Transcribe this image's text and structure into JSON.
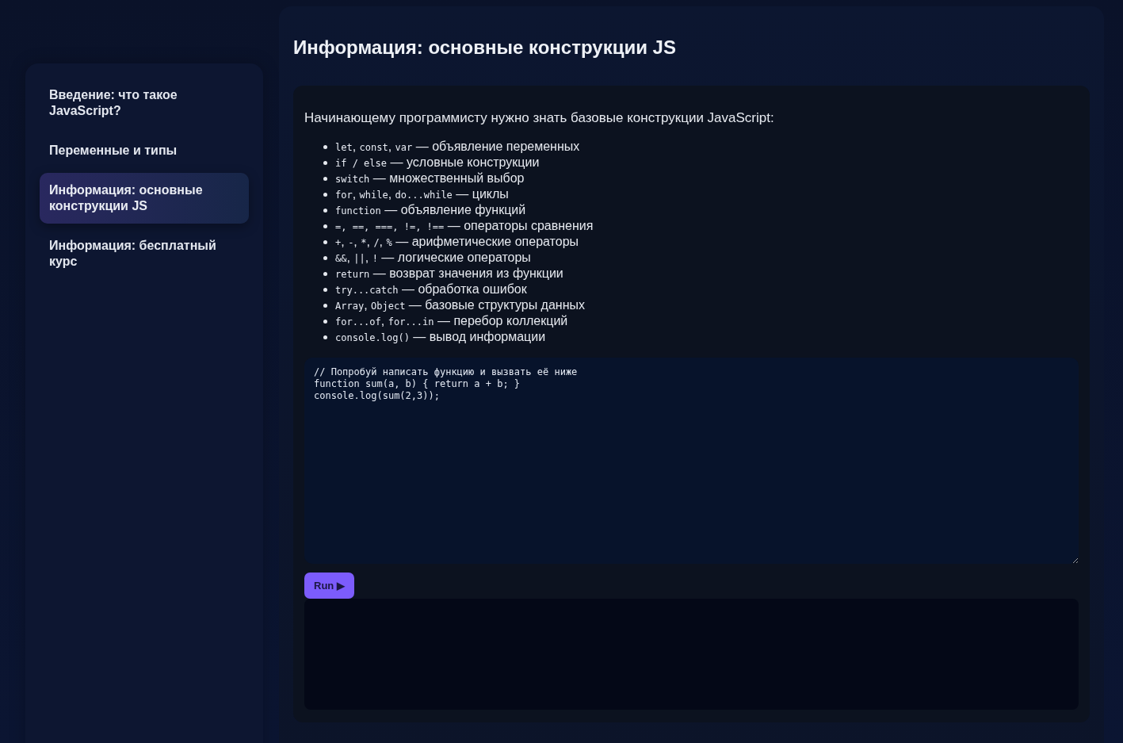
{
  "sidebar": {
    "items": [
      {
        "label": "Введение: что такое JavaScript?",
        "selected": false
      },
      {
        "label": "Переменные и типы",
        "selected": false
      },
      {
        "label": "Информация: основные конструкции JS",
        "selected": true
      },
      {
        "label": "Информация: бесплатный курс",
        "selected": false
      }
    ]
  },
  "main": {
    "title": "Информация: основные конструкции JS",
    "intro": "Начинающему программисту нужно знать базовые конструкции JavaScript:",
    "constructs": [
      {
        "parts": [
          {
            "kind": "code",
            "text": "let"
          },
          {
            "kind": "text",
            "text": ", "
          },
          {
            "kind": "code",
            "text": "const"
          },
          {
            "kind": "text",
            "text": ", "
          },
          {
            "kind": "code",
            "text": "var"
          },
          {
            "kind": "text",
            "text": " — объявление переменных"
          }
        ]
      },
      {
        "parts": [
          {
            "kind": "code",
            "text": "if / else"
          },
          {
            "kind": "text",
            "text": " — условные конструкции"
          }
        ]
      },
      {
        "parts": [
          {
            "kind": "code",
            "text": "switch"
          },
          {
            "kind": "text",
            "text": " — множественный выбор"
          }
        ]
      },
      {
        "parts": [
          {
            "kind": "code",
            "text": "for"
          },
          {
            "kind": "text",
            "text": ", "
          },
          {
            "kind": "code",
            "text": "while"
          },
          {
            "kind": "text",
            "text": ", "
          },
          {
            "kind": "code",
            "text": "do...while"
          },
          {
            "kind": "text",
            "text": " — циклы"
          }
        ]
      },
      {
        "parts": [
          {
            "kind": "code",
            "text": "function"
          },
          {
            "kind": "text",
            "text": " — объявление функций"
          }
        ]
      },
      {
        "parts": [
          {
            "kind": "code",
            "text": "=, ==, ===, !=, !=="
          },
          {
            "kind": "text",
            "text": " — операторы сравнения"
          }
        ]
      },
      {
        "parts": [
          {
            "kind": "code",
            "text": "+"
          },
          {
            "kind": "text",
            "text": ", "
          },
          {
            "kind": "code",
            "text": "-"
          },
          {
            "kind": "text",
            "text": ", "
          },
          {
            "kind": "code",
            "text": "*"
          },
          {
            "kind": "text",
            "text": ", "
          },
          {
            "kind": "code",
            "text": "/"
          },
          {
            "kind": "text",
            "text": ", "
          },
          {
            "kind": "code",
            "text": "%"
          },
          {
            "kind": "text",
            "text": " — арифметические операторы"
          }
        ]
      },
      {
        "parts": [
          {
            "kind": "code",
            "text": "&&"
          },
          {
            "kind": "text",
            "text": ", "
          },
          {
            "kind": "code",
            "text": "||"
          },
          {
            "kind": "text",
            "text": ", "
          },
          {
            "kind": "code",
            "text": "!"
          },
          {
            "kind": "text",
            "text": " — логические операторы"
          }
        ]
      },
      {
        "parts": [
          {
            "kind": "code",
            "text": "return"
          },
          {
            "kind": "text",
            "text": " — возврат значения из функции"
          }
        ]
      },
      {
        "parts": [
          {
            "kind": "code",
            "text": "try...catch"
          },
          {
            "kind": "text",
            "text": " — обработка ошибок"
          }
        ]
      },
      {
        "parts": [
          {
            "kind": "code",
            "text": "Array"
          },
          {
            "kind": "text",
            "text": ", "
          },
          {
            "kind": "code",
            "text": "Object"
          },
          {
            "kind": "text",
            "text": " — базовые структуры данных"
          }
        ]
      },
      {
        "parts": [
          {
            "kind": "code",
            "text": "for...of"
          },
          {
            "kind": "text",
            "text": ", "
          },
          {
            "kind": "code",
            "text": "for...in"
          },
          {
            "kind": "text",
            "text": " — перебор коллекций"
          }
        ]
      },
      {
        "parts": [
          {
            "kind": "code",
            "text": "console.log()"
          },
          {
            "kind": "text",
            "text": " — вывод информации"
          }
        ]
      }
    ],
    "editor": {
      "value": "// Попробуй написать функцию и вызвать её ниже\nfunction sum(a, b) { return a + b; }\nconsole.log(sum(2,3));"
    },
    "run_button": {
      "label": "Run ▶"
    }
  }
}
